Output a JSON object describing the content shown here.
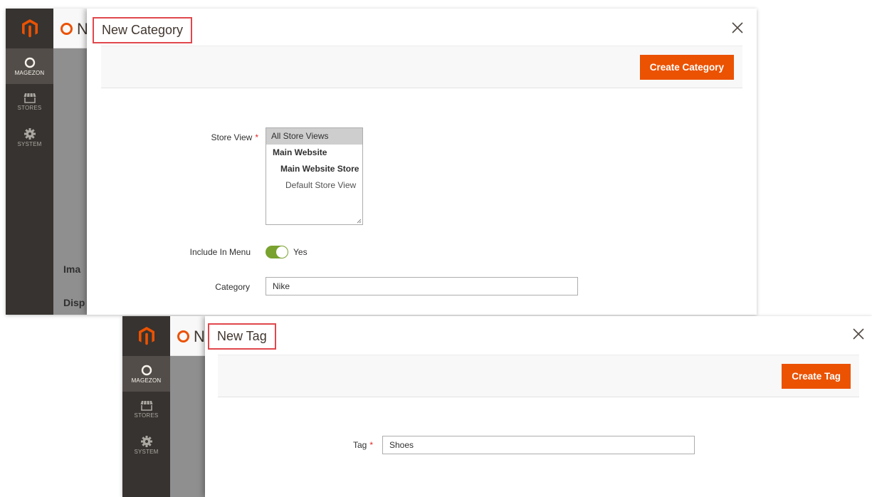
{
  "category_dialog": {
    "title": "New Category",
    "primary_action": "Create Category",
    "sidebar": [
      {
        "label": "MAGEZON",
        "icon": "magezon-ring-icon"
      },
      {
        "label": "STORES",
        "icon": "store-icon"
      },
      {
        "label": "SYSTEM",
        "icon": "gear-icon"
      }
    ],
    "behind_partial_text": {
      "title_fragment": "N",
      "row1": "Ima",
      "row2": "Disp"
    },
    "fields": {
      "store_view": {
        "label": "Store View",
        "required": "*",
        "options": [
          {
            "text": "All Store Views",
            "selected": true
          },
          {
            "text": "Main Website"
          },
          {
            "text": "Main Website Store"
          },
          {
            "text": "Default Store View"
          }
        ]
      },
      "include_in_menu": {
        "label": "Include In Menu",
        "value": "Yes",
        "on": true
      },
      "category": {
        "label": "Category",
        "value": "Nike"
      }
    }
  },
  "tag_dialog": {
    "title": "New Tag",
    "primary_action": "Create Tag",
    "sidebar": [
      {
        "label": "MAGEZON",
        "icon": "magezon-ring-icon"
      },
      {
        "label": "STORES",
        "icon": "store-icon"
      },
      {
        "label": "SYSTEM",
        "icon": "gear-icon"
      }
    ],
    "behind_partial_text": {
      "title_fragment": "N"
    },
    "fields": {
      "tag": {
        "label": "Tag",
        "required": "*",
        "value": "Shoes"
      }
    }
  },
  "colors": {
    "accent": "#eb5202",
    "sidebar": "#373330",
    "toggle_on": "#79a22e",
    "highlight_box": "#e0474c"
  }
}
